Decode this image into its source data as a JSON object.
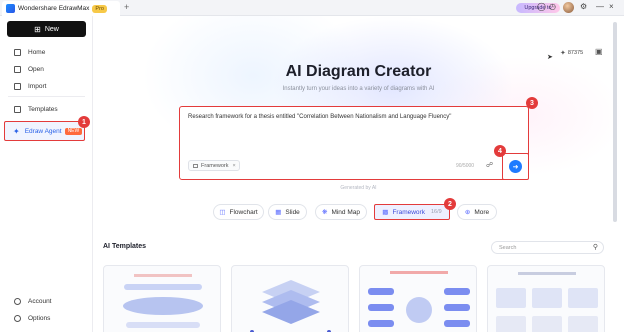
{
  "titlebar": {
    "app_title": "Wondershare EdrawMax",
    "pro_badge": "Pro",
    "upgrade_label": "Upgrade to",
    "tab_add": "+",
    "close": "×"
  },
  "sidebar": {
    "new_label": "New",
    "items": [
      {
        "label": "Home",
        "icon": "home-icon"
      },
      {
        "label": "Open",
        "icon": "open-icon"
      },
      {
        "label": "Import",
        "icon": "import-icon"
      },
      {
        "label": "Templates",
        "icon": "templates-icon"
      }
    ],
    "agent": {
      "label": "Edraw Agent",
      "badge": "NEW"
    },
    "bottom": [
      {
        "label": "Account",
        "icon": "account-icon"
      },
      {
        "label": "Options",
        "icon": "options-icon"
      }
    ]
  },
  "main": {
    "credits": "87375",
    "title": "AI Diagram Creator",
    "subtitle": "Instantly turn your ideas into a variety of diagrams with AI",
    "prompt": "Research framework for a thesis entitled \"Correlation Between Nationalism and Language Fluency\"",
    "chip_label": "Framework",
    "counter": "90/5000",
    "generated_note": "Generated by AI",
    "pills": [
      {
        "label": "Flowchart",
        "icon": "flowchart-icon"
      },
      {
        "label": "Slide",
        "icon": "slide-icon"
      },
      {
        "label": "Mind Map",
        "icon": "mind-map-icon"
      },
      {
        "label": "Framework",
        "icon": "framework-icon",
        "count": "16/9",
        "active": true
      },
      {
        "label": "More",
        "icon": "more-icon"
      }
    ],
    "templates_title": "AI Templates",
    "search_placeholder": "Search"
  },
  "callouts": [
    "1",
    "2",
    "3",
    "4"
  ],
  "colors": {
    "accent": "#1f7bff",
    "highlight": "#e33b3b",
    "agent": "#2a62e8"
  }
}
